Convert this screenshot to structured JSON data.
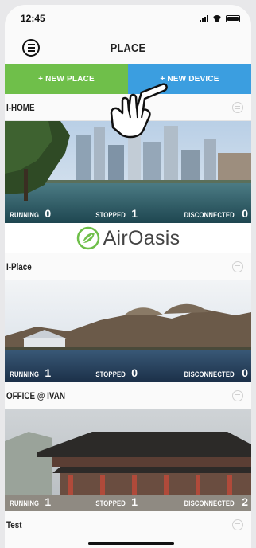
{
  "status_bar": {
    "time": "12:45"
  },
  "header": {
    "title": "PLACE"
  },
  "actions": {
    "new_place": "+ NEW PLACE",
    "new_device": "+ NEW DEVICE"
  },
  "places": [
    {
      "name": "I-HOME",
      "running_label": "RUNNING",
      "running": "0",
      "stopped_label": "STOPPED",
      "stopped": "1",
      "disconnected_label": "DISCONNECTED",
      "disconnected": "0"
    },
    {
      "name": "I-Place",
      "running_label": "RUNNING",
      "running": "1",
      "stopped_label": "STOPPED",
      "stopped": "0",
      "disconnected_label": "DISCONNECTED",
      "disconnected": "0"
    },
    {
      "name": "OFFICE @ IVAN",
      "running_label": "RUNNING",
      "running": "1",
      "stopped_label": "STOPPED",
      "stopped": "1",
      "disconnected_label": "DISCONNECTED",
      "disconnected": "2"
    },
    {
      "name": "Test"
    }
  ],
  "brand": {
    "name": "AirOasis"
  },
  "colors": {
    "new_place": "#6fbf4a",
    "new_device": "#3b9ee0"
  }
}
